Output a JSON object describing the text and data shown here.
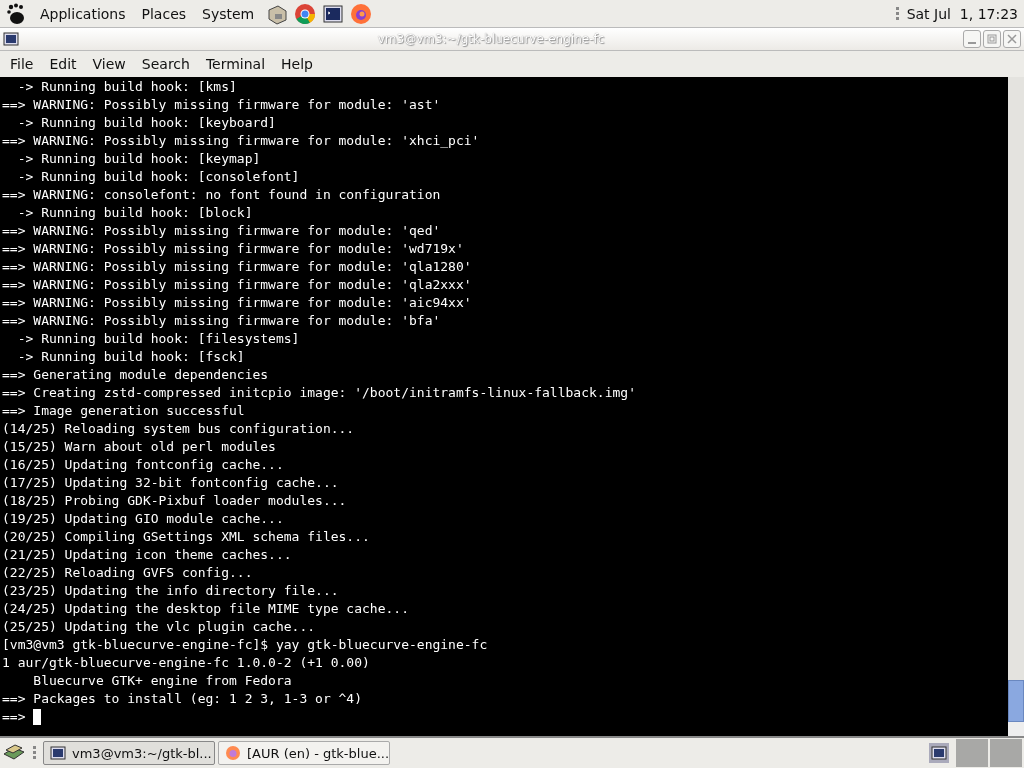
{
  "top_panel": {
    "menus": [
      "Applications",
      "Places",
      "System"
    ],
    "clock": "Sat Jul  1, 17:23"
  },
  "window": {
    "title": "vm3@vm3:~/gtk-bluecurve-engine-fc"
  },
  "menu_bar": [
    "File",
    "Edit",
    "View",
    "Search",
    "Terminal",
    "Help"
  ],
  "terminal": {
    "lines": [
      "  -> Running build hook: [kms]",
      "==> WARNING: Possibly missing firmware for module: 'ast'",
      "  -> Running build hook: [keyboard]",
      "==> WARNING: Possibly missing firmware for module: 'xhci_pci'",
      "  -> Running build hook: [keymap]",
      "  -> Running build hook: [consolefont]",
      "==> WARNING: consolefont: no font found in configuration",
      "  -> Running build hook: [block]",
      "==> WARNING: Possibly missing firmware for module: 'qed'",
      "==> WARNING: Possibly missing firmware for module: 'wd719x'",
      "==> WARNING: Possibly missing firmware for module: 'qla1280'",
      "==> WARNING: Possibly missing firmware for module: 'qla2xxx'",
      "==> WARNING: Possibly missing firmware for module: 'aic94xx'",
      "==> WARNING: Possibly missing firmware for module: 'bfa'",
      "  -> Running build hook: [filesystems]",
      "  -> Running build hook: [fsck]",
      "==> Generating module dependencies",
      "==> Creating zstd-compressed initcpio image: '/boot/initramfs-linux-fallback.img'",
      "==> Image generation successful",
      "(14/25) Reloading system bus configuration...",
      "(15/25) Warn about old perl modules",
      "(16/25) Updating fontconfig cache...",
      "(17/25) Updating 32-bit fontconfig cache...",
      "(18/25) Probing GDK-Pixbuf loader modules...",
      "(19/25) Updating GIO module cache...",
      "(20/25) Compiling GSettings XML schema files...",
      "(21/25) Updating icon theme caches...",
      "(22/25) Reloading GVFS config...",
      "(23/25) Updating the info directory file...",
      "(24/25) Updating the desktop file MIME type cache...",
      "(25/25) Updating the vlc plugin cache...",
      "[vm3@vm3 gtk-bluecurve-engine-fc]$ yay gtk-bluecurve-engine-fc",
      "1 aur/gtk-bluecurve-engine-fc 1.0.0-2 (+1 0.00)",
      "    Bluecurve GTK+ engine from Fedora",
      "==> Packages to install (eg: 1 2 3, 1-3 or ^4)"
    ],
    "prompt": "==> "
  },
  "taskbar": {
    "tasks": [
      {
        "label": "vm3@vm3:~/gtk-bl...",
        "kind": "terminal",
        "selected": true
      },
      {
        "label": "[AUR (en) - gtk-blue...",
        "kind": "browser",
        "selected": false
      }
    ]
  }
}
